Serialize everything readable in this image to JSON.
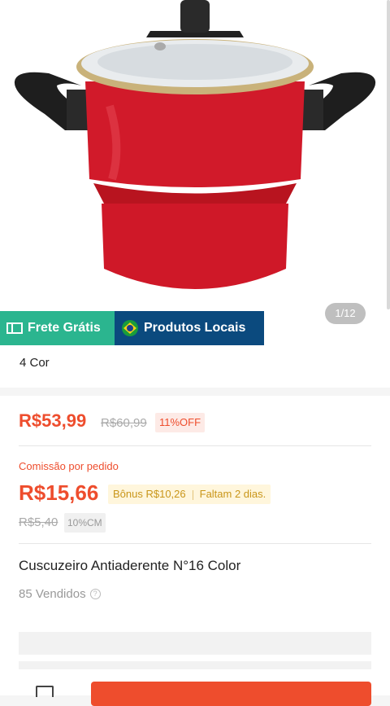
{
  "hero": {
    "image_alt": "Red steamer pot with glass lid",
    "counter": "1/12"
  },
  "badges": {
    "free_shipping": "Frete Grátis",
    "local_products": "Produtos Locais"
  },
  "variants": {
    "label": "4 Cor"
  },
  "pricing": {
    "price": "R$53,99",
    "original_price": "R$60,99",
    "discount": "11%OFF"
  },
  "commission": {
    "label": "Comissão por pedido",
    "value": "R$15,66",
    "bonus": "Bônus R$10,26",
    "remaining": "Faltam 2 dias.",
    "original_value": "R$5,40",
    "rate": "10%CM"
  },
  "product": {
    "title": "Cuscuzeiro Antiaderente N°16 Color",
    "sold": "85 Vendidos"
  },
  "colors": {
    "accent": "#ee4d2d",
    "free_shipping": "#2bb58f",
    "local": "#0b4a7e",
    "bonus_bg": "#fff6dc"
  }
}
